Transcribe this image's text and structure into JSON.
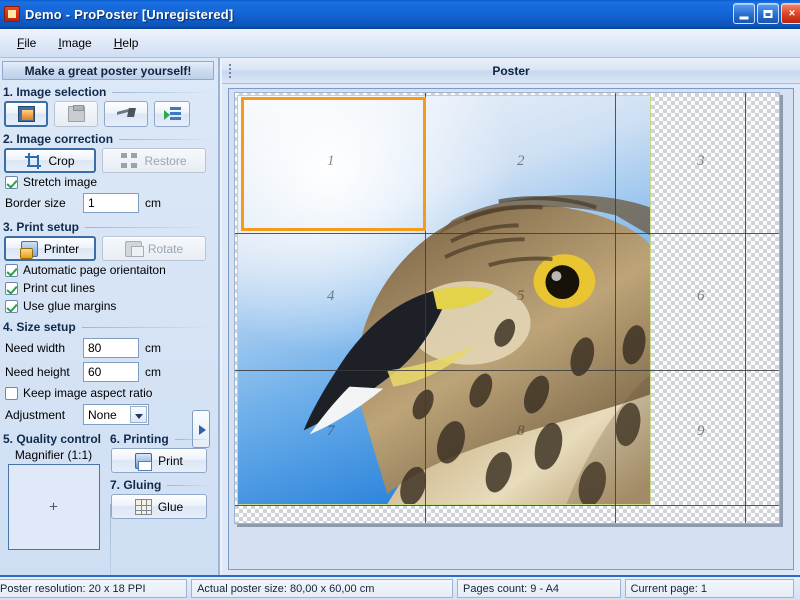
{
  "window": {
    "title": "Demo - ProPoster [Unregistered]",
    "app_icon": "app-icon",
    "minimize_label": "",
    "maximize_label": "",
    "close_label": "×"
  },
  "menu": {
    "items": [
      {
        "label": "File",
        "accel": "F"
      },
      {
        "label": "Image",
        "accel": "I"
      },
      {
        "label": "Help",
        "accel": "H"
      }
    ]
  },
  "sidebar": {
    "header": "Make a great poster yourself!",
    "sections": {
      "image_selection": {
        "title": "1. Image selection",
        "buttons": [
          {
            "name": "open-image-button",
            "icon": "open-image-icon",
            "label": "",
            "state": "focused"
          },
          {
            "name": "paste-image-button",
            "icon": "clipboard-paste-icon",
            "label": "",
            "state": "disabled"
          },
          {
            "name": "scan-image-button",
            "icon": "scanner-icon",
            "label": "",
            "state": "disabled"
          },
          {
            "name": "image-list-button",
            "icon": "layers-green-icon",
            "label": "",
            "state": "normal"
          }
        ]
      },
      "image_correction": {
        "title": "2. Image correction",
        "crop_label": "Crop",
        "crop_icon": "crop-icon",
        "restore_label": "Restore",
        "restore_icon": "restore-icon",
        "stretch_label": "Stretch image",
        "stretch_checked": true,
        "border_label": "Border size",
        "border_value": "1",
        "border_unit": "cm"
      },
      "print_setup": {
        "title": "3. Print setup",
        "printer_label": "Printer",
        "printer_icon": "printer-icon",
        "rotate_label": "Rotate",
        "rotate_icon": "rotate-icon",
        "auto_orientation_label": "Automatic page orientaiton",
        "auto_orientation_checked": true,
        "cut_lines_label": "Print cut lines",
        "cut_lines_checked": true,
        "glue_margins_label": "Use glue margins",
        "glue_margins_checked": true
      },
      "size_setup": {
        "title": "4. Size setup",
        "width_label": "Need width",
        "width_value": "80",
        "width_unit": "cm",
        "height_label": "Need height",
        "height_value": "60",
        "height_unit": "cm",
        "aspect_label": "Keep image aspect ratio",
        "aspect_checked": false,
        "adjustment_label": "Adjustment",
        "adjustment_value": "None",
        "expand_icon": "arrow-right-icon"
      },
      "quality_control": {
        "title": "5. Quality control",
        "magnifier_label": "Magnifier (1:1)",
        "crosshair": "+"
      },
      "printing": {
        "title": "6. Printing",
        "print_label": "Print",
        "print_icon": "print-icon"
      },
      "gluing": {
        "title": "7. Gluing",
        "glue_label": "Glue",
        "glue_icon": "glue-grid-icon"
      }
    }
  },
  "poster_panel": {
    "title": "Poster",
    "grip_icon": "drag-grip-icon",
    "page_numbers": [
      "1",
      "2",
      "3",
      "4",
      "5",
      "6",
      "7",
      "8",
      "9"
    ],
    "selection_page": "1",
    "selection_color": "#f59b18",
    "grid_columns": 3,
    "grid_rows": 3
  },
  "statusbar": {
    "resolution": "Poster resolution: 20 x 18 PPI",
    "actual_size": "Actual poster size: 80,00 x 60,00 cm",
    "pages_count": "Pages count: 9 - A4",
    "current_page": "Current page: 1"
  }
}
